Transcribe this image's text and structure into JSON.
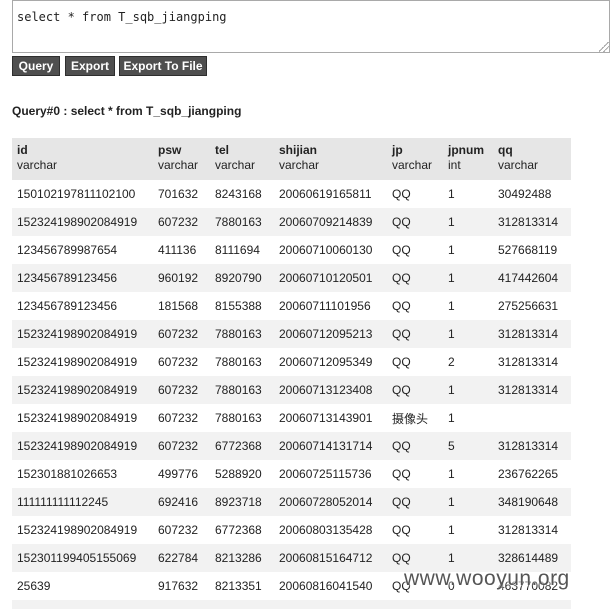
{
  "sql_input": {
    "value": "select * from T_sqb_jiangping"
  },
  "buttons": {
    "query": "Query",
    "export": "Export",
    "export_file": "Export To File"
  },
  "query_title": "Query#0 : select * from T_sqb_jiangping",
  "table": {
    "columns": [
      {
        "name": "id",
        "type": "varchar"
      },
      {
        "name": "psw",
        "type": "varchar"
      },
      {
        "name": "tel",
        "type": "varchar"
      },
      {
        "name": "shijian",
        "type": "varchar"
      },
      {
        "name": "jp",
        "type": "varchar"
      },
      {
        "name": "jpnum",
        "type": "int"
      },
      {
        "name": "qq",
        "type": "varchar"
      }
    ],
    "rows": [
      [
        "150102197811102100",
        "701632",
        "8243168",
        "20060619165811",
        "QQ",
        "1",
        "30492488"
      ],
      [
        "152324198902084919",
        "607232",
        "7880163",
        "20060709214839",
        "QQ",
        "1",
        "312813314"
      ],
      [
        "123456789987654",
        "411136",
        "8111694",
        "20060710060130",
        "QQ",
        "1",
        "527668119"
      ],
      [
        "123456789123456",
        "960192",
        "8920790",
        "20060710120501",
        "QQ",
        "1",
        "417442604"
      ],
      [
        "123456789123456",
        "181568",
        "8155388",
        "20060711101956",
        "QQ",
        "1",
        "275256631"
      ],
      [
        "152324198902084919",
        "607232",
        "7880163",
        "20060712095213",
        "QQ",
        "1",
        "312813314"
      ],
      [
        "152324198902084919",
        "607232",
        "7880163",
        "20060712095349",
        "QQ",
        "2",
        "312813314"
      ],
      [
        "152324198902084919",
        "607232",
        "7880163",
        "20060713123408",
        "QQ",
        "1",
        "312813314"
      ],
      [
        "152324198902084919",
        "607232",
        "7880163",
        "20060713143901",
        "摄像头",
        "1",
        ""
      ],
      [
        "152324198902084919",
        "607232",
        "6772368",
        "20060714131714",
        "QQ",
        "5",
        "312813314"
      ],
      [
        "152301881026653",
        "499776",
        "5288920",
        "20060725115736",
        "QQ",
        "1",
        "236762265"
      ],
      [
        "111111111112245",
        "692416",
        "8923718",
        "20060728052014",
        "QQ",
        "1",
        "348190648"
      ],
      [
        "152324198902084919",
        "607232",
        "6772368",
        "20060803135428",
        "QQ",
        "1",
        "312813314"
      ],
      [
        "152301199405155069",
        "622784",
        "8213286",
        "20060815164712",
        "QQ",
        "1",
        "328614489"
      ],
      [
        "25639",
        "917632",
        "8213351",
        "20060816041540",
        "QQ",
        "0",
        "463770082"
      ]
    ]
  },
  "watermark": "www.wooyun.org"
}
